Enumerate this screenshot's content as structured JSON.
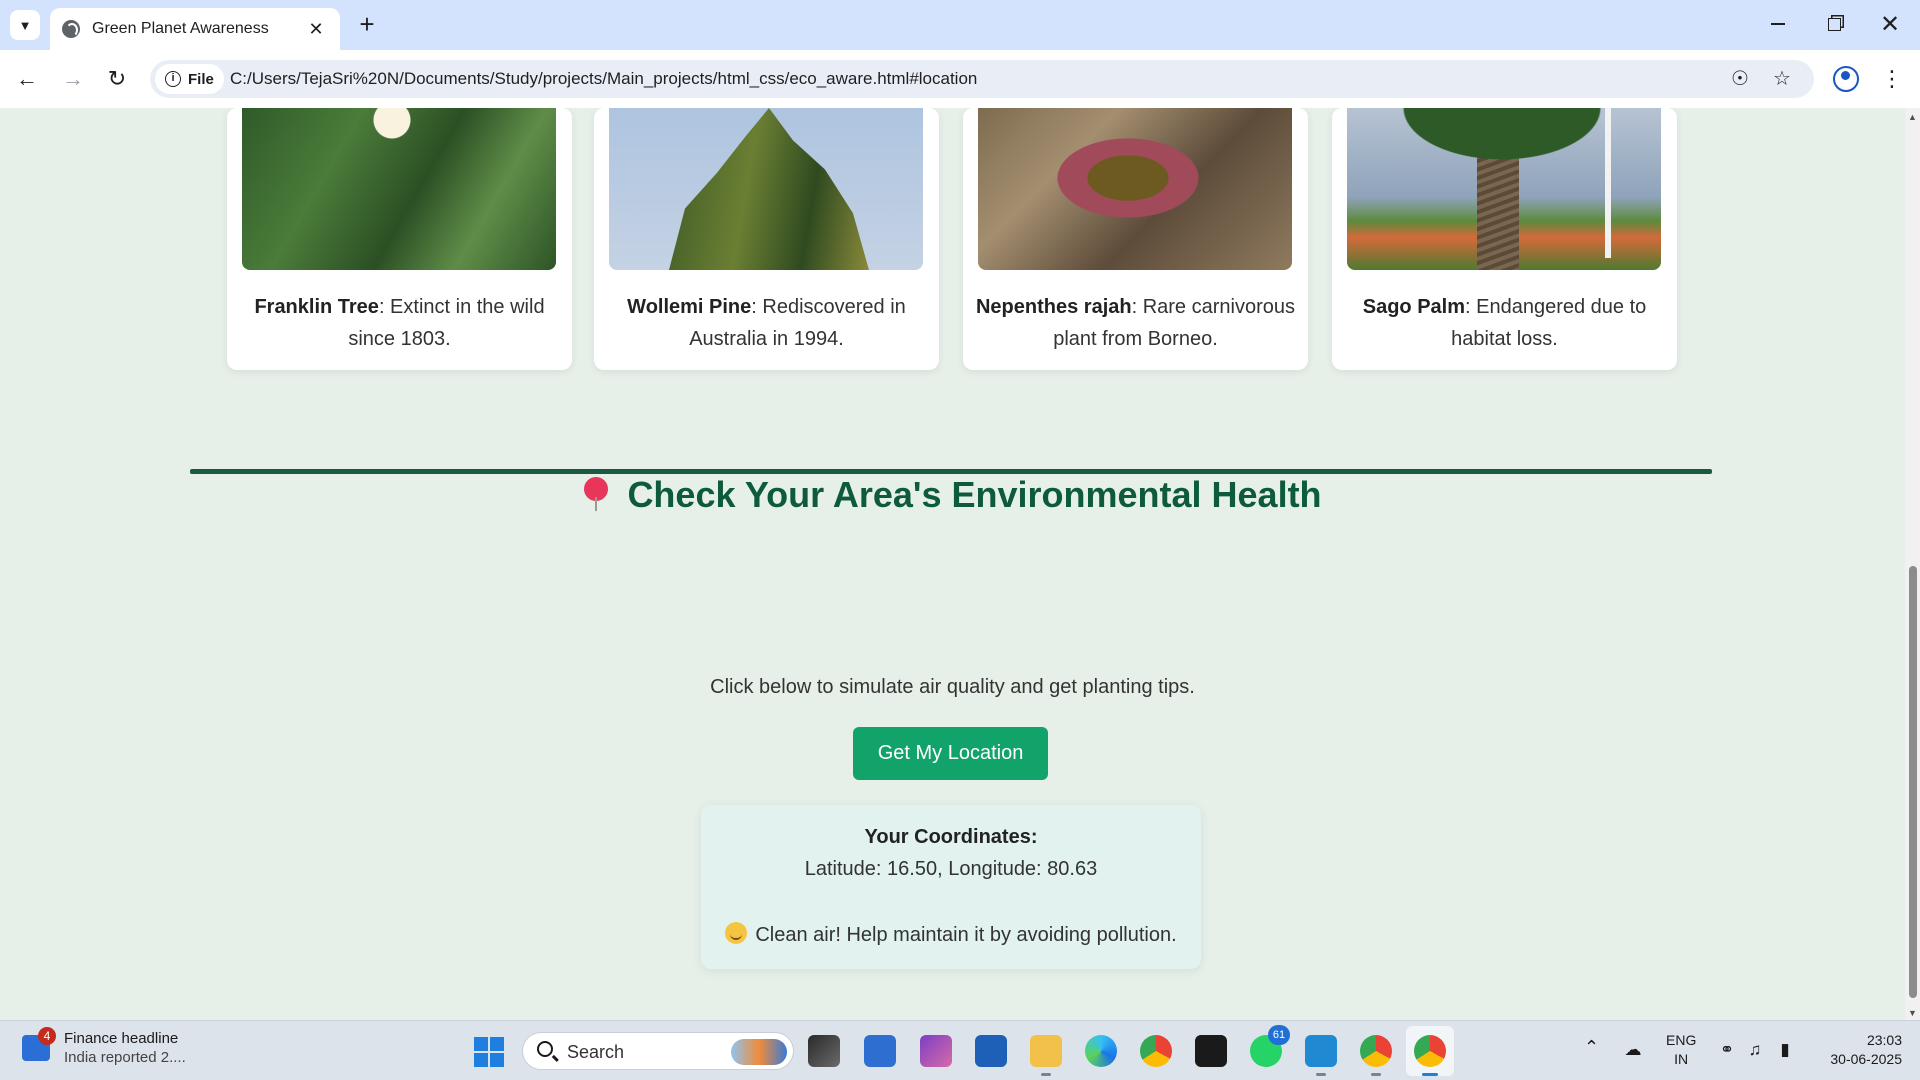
{
  "browser": {
    "tab_title": "Green Planet Awareness",
    "scheme_chip": "File",
    "url": "C:/Users/TejaSri%20N/Documents/Study/projects/Main_projects/html_css/eco_aware.html#location"
  },
  "plants": [
    {
      "name": "Franklin Tree",
      "desc": ": Extinct in the wild since 1803."
    },
    {
      "name": "Wollemi Pine",
      "desc": ": Rediscovered in Australia in 1994."
    },
    {
      "name": "Nepenthes rajah",
      "desc": ": Rare carnivorous plant from Borneo."
    },
    {
      "name": "Sago Palm",
      "desc": ": Endangered due to habitat loss."
    }
  ],
  "location": {
    "title": "Check Your Area's Environmental Health",
    "subtitle": "Click below to simulate air quality and get planting tips.",
    "button_label": "Get My Location",
    "coords_label": "Your Coordinates:",
    "coords_text": "Latitude: 16.50, Longitude: 80.63",
    "tip_text": "Clean air! Help maintain it by avoiding pollution."
  },
  "taskbar": {
    "news_badge": "4",
    "news_headline": "Finance headline",
    "news_sub": "India reported 2....",
    "search_label": "Search",
    "whatsapp_badge": "61",
    "lang_line1": "ENG",
    "lang_line2": "IN",
    "time": "23:03",
    "date": "30-06-2025"
  },
  "colors": {
    "page_bg": "#e6f0e9",
    "accent_green": "#0d5a3c",
    "button_green": "#12a36b",
    "divider": "#1a5a43"
  }
}
